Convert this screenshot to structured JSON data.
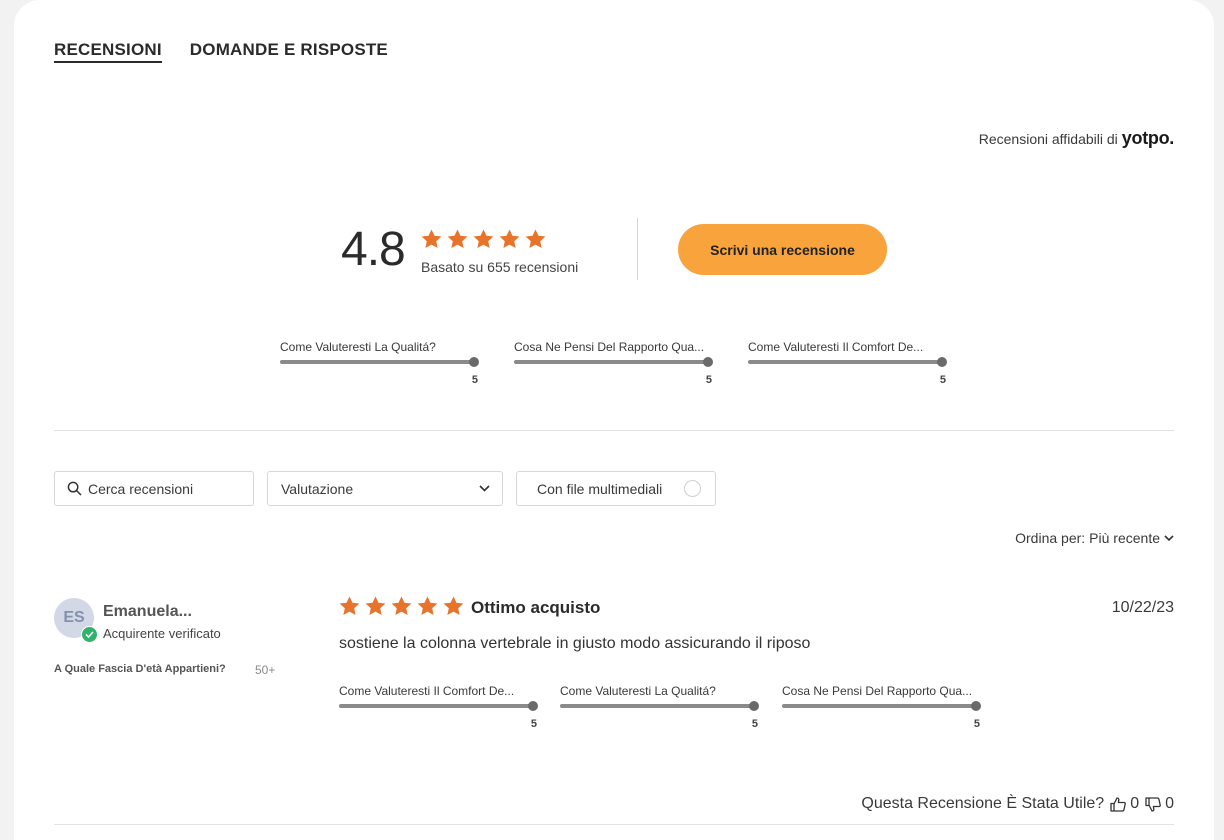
{
  "tabs": [
    {
      "label": "RECENSIONI",
      "active": true
    },
    {
      "label": "DOMANDE E RISPOSTE",
      "active": false
    }
  ],
  "trusted": {
    "text": "Recensioni affidabili di",
    "brand": "yotpo."
  },
  "summary": {
    "average": "4.8",
    "stars": 5,
    "based_on": "Basato su 655 recensioni",
    "write_button": "Scrivi una recensione"
  },
  "summary_sliders": [
    {
      "label": "Come Valuteresti La Qualitá?",
      "value": "5",
      "fraction": 1.0
    },
    {
      "label": "Cosa Ne Pensi Del Rapporto Qua...",
      "value": "5",
      "fraction": 1.0
    },
    {
      "label": "Come Valuteresti Il Comfort De...",
      "value": "5",
      "fraction": 1.0
    }
  ],
  "filters": {
    "search_placeholder": "Cerca recensioni",
    "rating_select": "Valutazione",
    "media_toggle": "Con file multimediali"
  },
  "sort": {
    "label": "Ordina per:",
    "value": "Più recente"
  },
  "review": {
    "initials": "ES",
    "author": "Emanuela...",
    "badge": "Acquirente verificato",
    "age_question": "A Quale Fascia D'età Appartieni?",
    "age_answer": "50+",
    "stars": 5,
    "title": "Ottimo acquisto",
    "date": "10/22/23",
    "body": "sostiene la colonna vertebrale in giusto modo assicurando il riposo",
    "sliders": [
      {
        "label": "Come Valuteresti Il Comfort De...",
        "value": "5",
        "fraction": 1.0
      },
      {
        "label": "Come Valuteresti La Qualitá?",
        "value": "5",
        "fraction": 1.0
      },
      {
        "label": "Cosa Ne Pensi Del Rapporto Qua...",
        "value": "5",
        "fraction": 1.0
      }
    ],
    "helpful_question": "Questa Recensione È Stata Utile?",
    "thumbs_up": "0",
    "thumbs_down": "0"
  },
  "colors": {
    "star": "#e8732a",
    "button": "#f9a33c",
    "verified": "#2fb36b"
  }
}
